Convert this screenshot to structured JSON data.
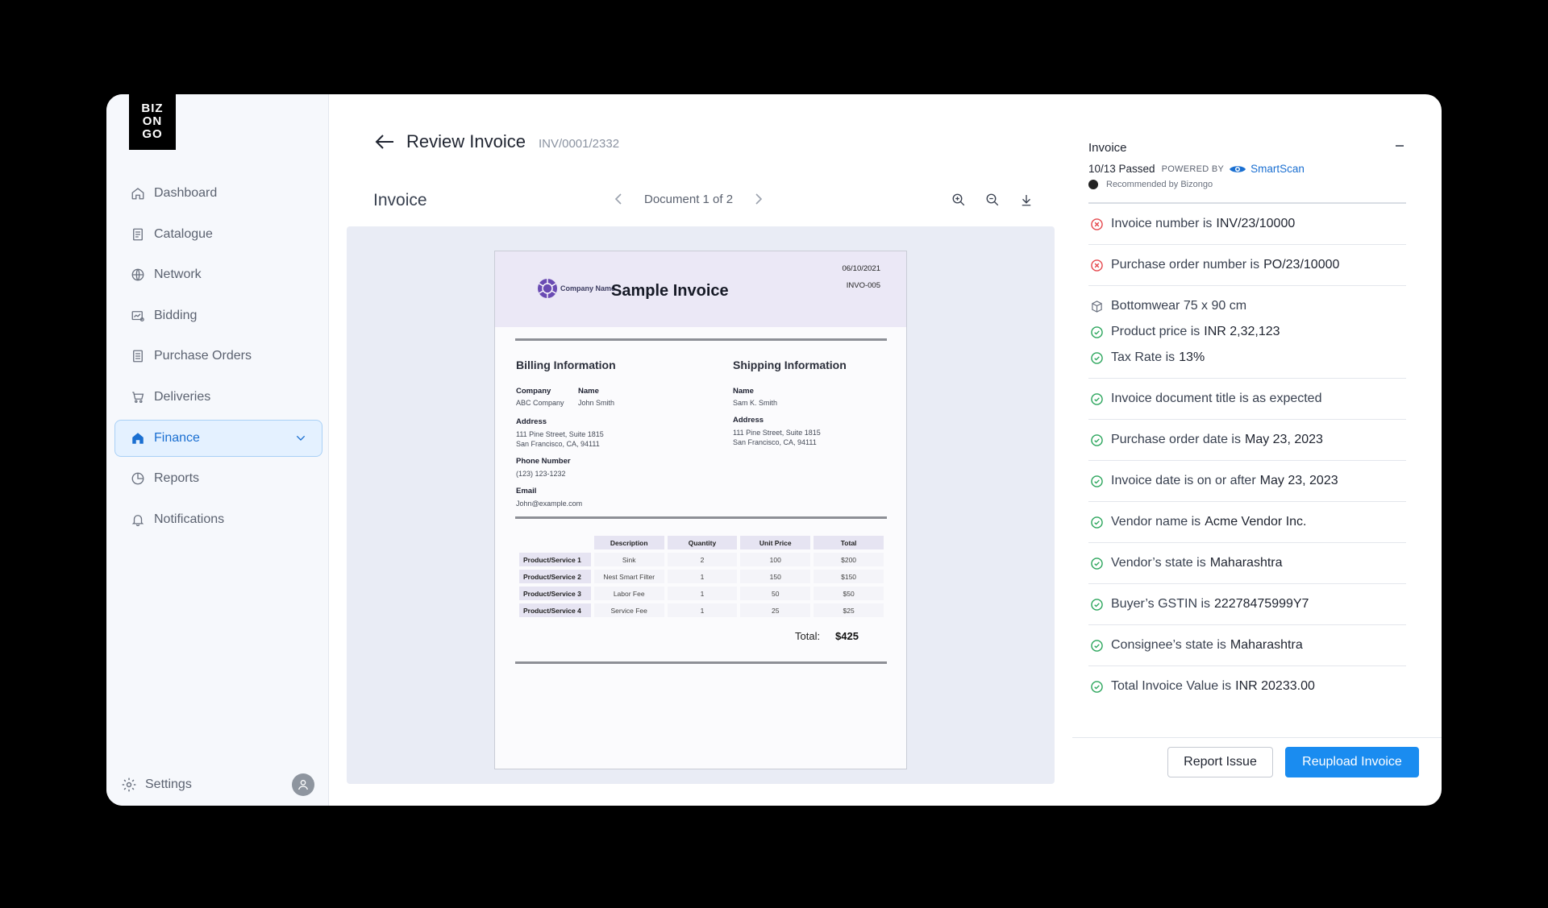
{
  "logo": {
    "line1": "BIZ",
    "line2": "ON",
    "line3": "GO"
  },
  "sidebar": {
    "items": [
      {
        "label": "Dashboard",
        "icon": "home-icon"
      },
      {
        "label": "Catalogue",
        "icon": "catalogue-icon"
      },
      {
        "label": "Network",
        "icon": "globe-icon"
      },
      {
        "label": "Bidding",
        "icon": "bidding-icon"
      },
      {
        "label": "Purchase Orders",
        "icon": "document-icon"
      },
      {
        "label": "Deliveries",
        "icon": "cart-icon"
      },
      {
        "label": "Finance",
        "icon": "home-filled-icon",
        "active": true
      },
      {
        "label": "Reports",
        "icon": "pie-chart-icon"
      },
      {
        "label": "Notifications",
        "icon": "bell-icon"
      }
    ],
    "settings_label": "Settings"
  },
  "header": {
    "title": "Review Invoice",
    "id": "INV/0001/2332"
  },
  "viewer": {
    "title": "Invoice",
    "doc_label": "Document 1 of 2"
  },
  "invoice": {
    "company_logo": "Company Name",
    "title": "Sample Invoice",
    "date": "06/10/2021",
    "number": "INVO-005",
    "billing": {
      "title": "Billing Information",
      "company_label": "Company",
      "company": "ABC Company",
      "name_label": "Name",
      "name": "John Smith",
      "address_label": "Address",
      "address1": "111 Pine Street, Suite 1815",
      "address2": "San Francisco, CA, 94111",
      "phone_label": "Phone Number",
      "phone": "(123) 123-1232",
      "email_label": "Email",
      "email": "John@example.com"
    },
    "shipping": {
      "title": "Shipping Information",
      "name_label": "Name",
      "name": "Sam K. Smith",
      "address_label": "Address",
      "address1": "111 Pine Street, Suite 1815",
      "address2": "San Francisco, CA, 94111"
    },
    "table": {
      "headers": [
        "Description",
        "Quantity",
        "Unit Price",
        "Total"
      ],
      "rows": [
        [
          "Product/Service 1",
          "Sink",
          "2",
          "100",
          "$200"
        ],
        [
          "Product/Service 2",
          "Nest Smart Filter",
          "1",
          "150",
          "$150"
        ],
        [
          "Product/Service 3",
          "Labor Fee",
          "1",
          "50",
          "$50"
        ],
        [
          "Product/Service 4",
          "Service Fee",
          "1",
          "25",
          "$25"
        ]
      ]
    },
    "total_label": "Total:",
    "total_value": "$425"
  },
  "panel": {
    "title": "Invoice",
    "passed": "10/13 Passed",
    "powered_by": "POWERED BY",
    "brand": "SmartScan",
    "recommended": "Recommended by Bizongo",
    "checks": [
      {
        "status": "fail",
        "text": "Invoice number is",
        "value": "INV/23/10000"
      },
      {
        "status": "fail",
        "text": "Purchase order number is",
        "value": "PO/23/10000"
      },
      {
        "status": "item",
        "text": "Bottomwear 75 x 90 cm",
        "value": ""
      },
      {
        "status": "pass",
        "text": "Product price is",
        "value": "INR 2,32,123"
      },
      {
        "status": "pass",
        "text": "Tax Rate is",
        "value": "13%"
      },
      {
        "status": "pass",
        "text": "Invoice document title is as expected",
        "value": ""
      },
      {
        "status": "pass",
        "text": "Purchase order date is",
        "value": "May 23, 2023"
      },
      {
        "status": "pass",
        "text": "Invoice date is on or after",
        "value": "May 23, 2023"
      },
      {
        "status": "pass",
        "text": "Vendor name is",
        "value": "Acme Vendor Inc."
      },
      {
        "status": "pass",
        "text": "Vendor’s state is",
        "value": "Maharashtra"
      },
      {
        "status": "pass",
        "text": "Buyer’s GSTIN is",
        "value": "22278475999Y7"
      },
      {
        "status": "pass",
        "text": "Consignee’s state is",
        "value": "Maharashtra"
      },
      {
        "status": "pass",
        "text": "Total Invoice Value is",
        "value": "INR 20233.00"
      }
    ],
    "report_label": "Report Issue",
    "reupload_label": "Reupload Invoice"
  },
  "colors": {
    "accent": "#1a8cf0",
    "pass": "#2aa55b",
    "fail": "#e5484d",
    "active_bg": "#e4f1ff"
  }
}
